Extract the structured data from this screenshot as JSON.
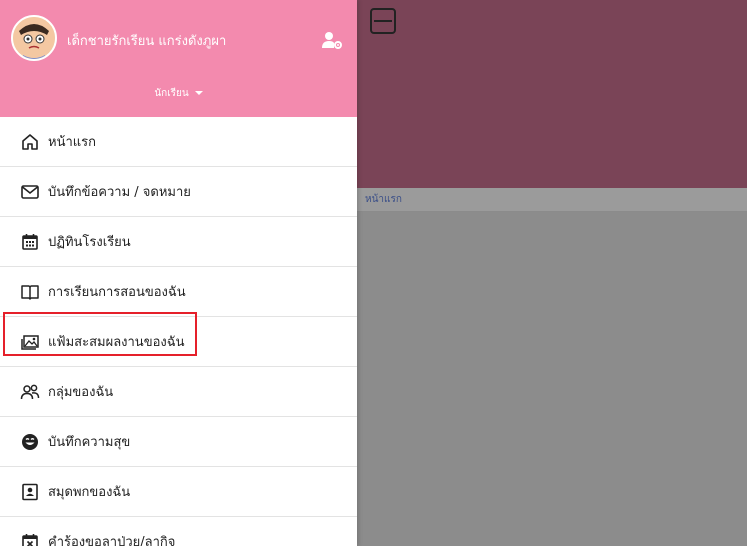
{
  "user": {
    "name": "เด็กชายรักเรียน แกร่งดังภูผา",
    "role": "นักเรียน"
  },
  "menu": [
    {
      "label": "หน้าแรก",
      "icon": "home-icon"
    },
    {
      "label": "บันทึกข้อความ / จดหมาย",
      "icon": "envelope-icon"
    },
    {
      "label": "ปฏิทินโรงเรียน",
      "icon": "calendar-icon"
    },
    {
      "label": "การเรียนการสอนของฉัน",
      "icon": "book-open-icon"
    },
    {
      "label": "แฟ้มสะสมผลงานของฉัน",
      "icon": "portfolio-image-icon"
    },
    {
      "label": "กลุ่มของฉัน",
      "icon": "group-icon"
    },
    {
      "label": "บันทึกความสุข",
      "icon": "smile-icon"
    },
    {
      "label": "สมุดพกของฉัน",
      "icon": "contact-book-icon"
    },
    {
      "label": "คำร้องขอลาป่วย/ลากิจ",
      "icon": "calendar-x-icon"
    }
  ],
  "content": {
    "breadcrumb": "หน้าแรก"
  },
  "colors": {
    "header_bg": "#f38aae",
    "highlight": "#e5202a",
    "overlay_top": "#7a4457"
  }
}
